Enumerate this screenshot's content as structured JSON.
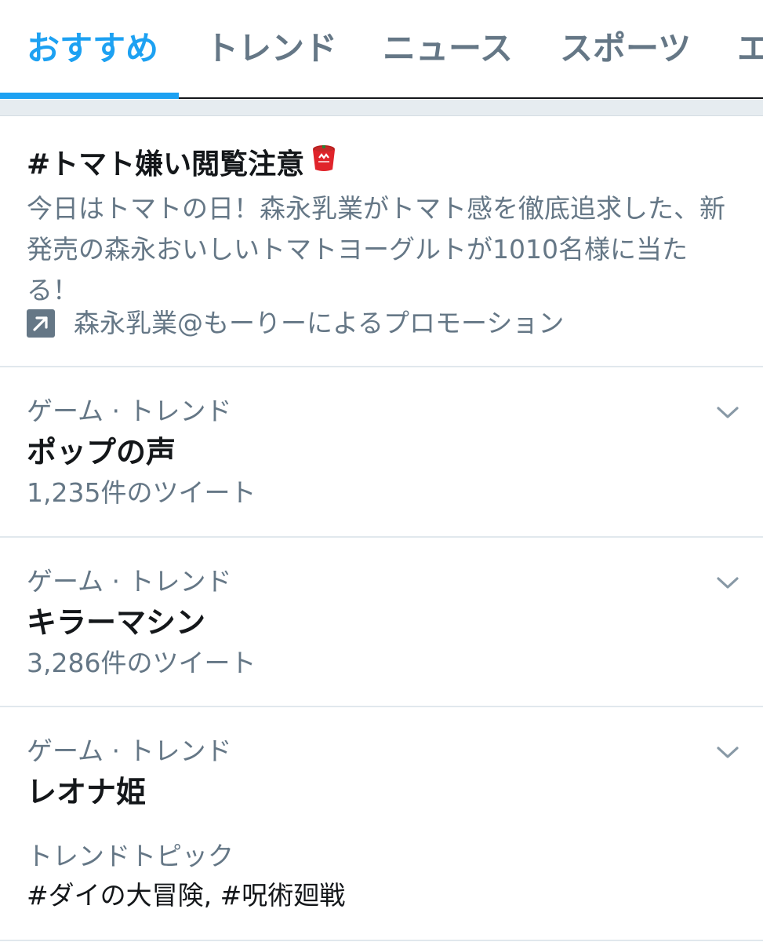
{
  "tabs": [
    {
      "label": "おすすめ",
      "active": true
    },
    {
      "label": "トレンド",
      "active": false
    },
    {
      "label": "ニュース",
      "active": false
    },
    {
      "label": "スポーツ",
      "active": false
    },
    {
      "label": "エ",
      "active": false
    }
  ],
  "promoted": {
    "title": "#トマト嫌い閲覧注意",
    "emoji": "tomato-yogurt-cup-icon",
    "description": "今日はトマトの日！森永乳業がトマト感を徹底追求した、新発売の森永おいしいトマトヨーグルトが1010名様に当たる！",
    "promoted_by": "森永乳業@もーりーによるプロモーション"
  },
  "trends": [
    {
      "context": "ゲーム · トレンド",
      "name": "ポップの声",
      "count": "1,235件のツイート"
    },
    {
      "context": "ゲーム · トレンド",
      "name": "キラーマシン",
      "count": "3,286件のツイート"
    },
    {
      "context": "ゲーム · トレンド",
      "name": "レオナ姫",
      "topic_label": "トレンドトピック",
      "topics": "#ダイの大冒険, #呪術廻戦"
    }
  ],
  "colors": {
    "accent": "#1da1f2",
    "secondary_text": "#657786",
    "primary_text": "#14171a",
    "divider": "#e1e8ed",
    "tomato_red": "#e0242b"
  }
}
